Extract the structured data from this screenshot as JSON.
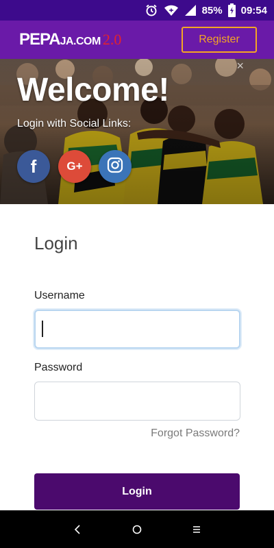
{
  "status_bar": {
    "battery": "85%",
    "time": "09:54",
    "icons": [
      "alarm-icon",
      "wifi-icon",
      "signal-icon",
      "battery-charging-icon"
    ]
  },
  "header": {
    "logo": {
      "part1": "PEPA",
      "part2": "JA.COM",
      "part3": "2.0"
    },
    "register_label": "Register",
    "colors": {
      "bar": "#6a1aa8",
      "status": "#3d0a8c",
      "accent": "#f5a623"
    }
  },
  "hero": {
    "close_glyph": "×",
    "title": "Welcome!",
    "social_label": "Login with Social Links:",
    "social_buttons": [
      {
        "icon": "facebook-icon",
        "glyph": "f",
        "color": "#3b5998"
      },
      {
        "icon": "google-plus-icon",
        "glyph": "G+",
        "color": "#dd4b39"
      },
      {
        "icon": "instagram-icon",
        "color": "#3b74b8"
      }
    ]
  },
  "form": {
    "title": "Login",
    "username_label": "Username",
    "username_value": "",
    "password_label": "Password",
    "password_value": "",
    "forgot_label": "Forgot Password?",
    "submit_label": "Login",
    "submit_color": "#4b0a6d"
  },
  "nav": {
    "buttons": [
      "back-icon",
      "home-icon",
      "menu-icon"
    ]
  }
}
